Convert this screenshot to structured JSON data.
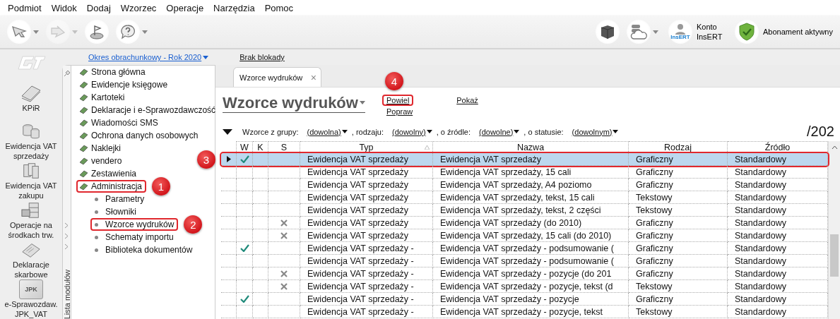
{
  "menu": [
    "Podmiot",
    "Widok",
    "Dodaj",
    "Wzorzec",
    "Operacje",
    "Narzędzia",
    "Pomoc"
  ],
  "toolbar": {
    "left": [
      {
        "kind": "back",
        "dropdown": true,
        "disabled": false
      },
      {
        "kind": "forward",
        "dropdown": true,
        "disabled": true
      },
      {
        "kind": "flag",
        "dropdown": false,
        "disabled": false
      },
      {
        "kind": "help",
        "dropdown": true,
        "disabled": false
      }
    ],
    "right": [
      {
        "kind": "cube",
        "dropdown": false
      },
      {
        "kind": "cloud",
        "dropdown": true
      }
    ],
    "account": {
      "badge": "InsERT",
      "label": "Konto InsERT"
    },
    "subscription": {
      "label": "Abonament aktywny"
    }
  },
  "period": {
    "label": "Okres obrachunkowy - Rok 2020",
    "lock": "Brak blokady"
  },
  "modules": [
    {
      "kind": "book",
      "label": "KPiR"
    },
    {
      "kind": "coins",
      "label": "Ewidencja VAT sprzedaży"
    },
    {
      "kind": "files",
      "label": "Ewidencja VAT zakupu"
    },
    {
      "kind": "cabinet",
      "label": "Operacje na środkach trw."
    },
    {
      "kind": "forms",
      "label": "Deklaracje skarbowe"
    },
    {
      "kind": "jpk",
      "badge": "JPK",
      "label": "e-Sprawozdaw. JPK_VAT"
    }
  ],
  "sidebar": {
    "caption": "Lista modułów",
    "items": [
      {
        "label": "Strona główna"
      },
      {
        "label": "Ewidencje księgowe"
      },
      {
        "label": "Kartoteki"
      },
      {
        "label": "Deklaracje i e-Sprawozdawczość"
      },
      {
        "label": "Wiadomości SMS"
      },
      {
        "label": "Ochrona danych osobowych"
      },
      {
        "label": "Naklejki"
      },
      {
        "label": "vendero"
      },
      {
        "label": "Zestawienia"
      },
      {
        "label": "Administracja",
        "callout": "1",
        "children": [
          {
            "label": "Parametry"
          },
          {
            "label": "Słowniki"
          },
          {
            "label": "Wzorce wydruków",
            "callout": "2"
          },
          {
            "label": "Schematy importu"
          },
          {
            "label": "Biblioteka dokumentów"
          }
        ]
      }
    ]
  },
  "tab": {
    "label": "Wzorce wydruków",
    "close": "×"
  },
  "title": "Wzorce wydruków",
  "actions": [
    {
      "label": "Powiel",
      "callout": "4"
    },
    {
      "label": "Popraw"
    },
    {
      "label": "Pokaż"
    }
  ],
  "filters": {
    "intro": "Wzorce z grupy:",
    "parts": [
      {
        "value": "(dowolna)"
      },
      {
        "prefix": ", rodzaju:",
        "value": "(dowolny)"
      },
      {
        "prefix": ", o źródle:",
        "value": "(dowolne)"
      },
      {
        "prefix": ", o statusie:",
        "value": "(dowolnym)"
      }
    ],
    "count": "/202"
  },
  "table": {
    "columns": [
      {
        "label": "W",
        "sorted": false
      },
      {
        "label": "K",
        "sorted": false
      },
      {
        "label": "S",
        "sorted": false
      },
      {
        "label": "Typ",
        "sorted": true
      },
      {
        "label": "Nazwa",
        "sorted": false
      },
      {
        "label": "Rodzaj",
        "sorted": false
      },
      {
        "label": "Źródło",
        "sorted": false
      }
    ],
    "rows": [
      {
        "selected": true,
        "callout": "3",
        "w": true,
        "s": false,
        "typ": "Ewidencja VAT sprzedaży",
        "nazwa": "Ewidencja VAT sprzedaży",
        "rodzaj": "Graficzny",
        "zrodlo": "Standardowy"
      },
      {
        "selected": false,
        "w": false,
        "s": false,
        "typ": "Ewidencja VAT sprzedaży",
        "nazwa": "Ewidencja VAT sprzedaży, 15 cali",
        "rodzaj": "Graficzny",
        "zrodlo": "Standardowy"
      },
      {
        "selected": false,
        "w": false,
        "s": false,
        "typ": "Ewidencja VAT sprzedaży",
        "nazwa": "Ewidencja VAT sprzedaży, A4 poziomo",
        "rodzaj": "Graficzny",
        "zrodlo": "Standardowy"
      },
      {
        "selected": false,
        "w": false,
        "s": false,
        "typ": "Ewidencja VAT sprzedaży",
        "nazwa": "Ewidencja VAT sprzedaży, tekst, 15 cali",
        "rodzaj": "Tekstowy",
        "zrodlo": "Standardowy"
      },
      {
        "selected": false,
        "w": false,
        "s": false,
        "typ": "Ewidencja VAT sprzedaży",
        "nazwa": "Ewidencja VAT sprzedaży, tekst, 2 części",
        "rodzaj": "Tekstowy",
        "zrodlo": "Standardowy"
      },
      {
        "selected": false,
        "w": false,
        "s": true,
        "typ": "Ewidencja VAT sprzedaży",
        "nazwa": "Ewidencja VAT sprzedaży (do 2010)",
        "rodzaj": "Graficzny",
        "zrodlo": "Standardowy"
      },
      {
        "selected": false,
        "w": false,
        "s": true,
        "typ": "Ewidencja VAT sprzedaży",
        "nazwa": "Ewidencja VAT sprzedaży, 15 cali (do 2010)",
        "rodzaj": "Graficzny",
        "zrodlo": "Standardowy"
      },
      {
        "selected": false,
        "w": true,
        "s": false,
        "typ": "Ewidencja VAT sprzedaży -",
        "nazwa": "Ewidencja VAT sprzedaży - podsumowanie (",
        "rodzaj": "Graficzny",
        "zrodlo": "Standardowy"
      },
      {
        "selected": false,
        "w": false,
        "s": false,
        "typ": "Ewidencja VAT sprzedaży -",
        "nazwa": "Ewidencja VAT sprzedaży - podsumowanie (",
        "rodzaj": "Graficzny",
        "zrodlo": "Standardowy"
      },
      {
        "selected": false,
        "w": false,
        "s": true,
        "typ": "Ewidencja VAT sprzedaży -",
        "nazwa": "Ewidencja VAT sprzedaży - pozycje (do 201",
        "rodzaj": "Graficzny",
        "zrodlo": "Standardowy"
      },
      {
        "selected": false,
        "w": false,
        "s": true,
        "typ": "Ewidencja VAT sprzedaży -",
        "nazwa": "Ewidencja VAT sprzedaży - pozycje, tekst (d",
        "rodzaj": "Tekstowy",
        "zrodlo": "Standardowy"
      },
      {
        "selected": false,
        "w": true,
        "s": false,
        "typ": "Ewidencja VAT sprzedaży -",
        "nazwa": "Ewidencja VAT sprzedaży - pozycje",
        "rodzaj": "Graficzny",
        "zrodlo": "Standardowy"
      },
      {
        "selected": false,
        "w": false,
        "s": false,
        "typ": "Ewidencja VAT sprzedaży -",
        "nazwa": "Ewidencja VAT sprzedaży - pozycje, tekst",
        "rodzaj": "Tekstowy",
        "zrodlo": "Standardowy"
      }
    ]
  }
}
